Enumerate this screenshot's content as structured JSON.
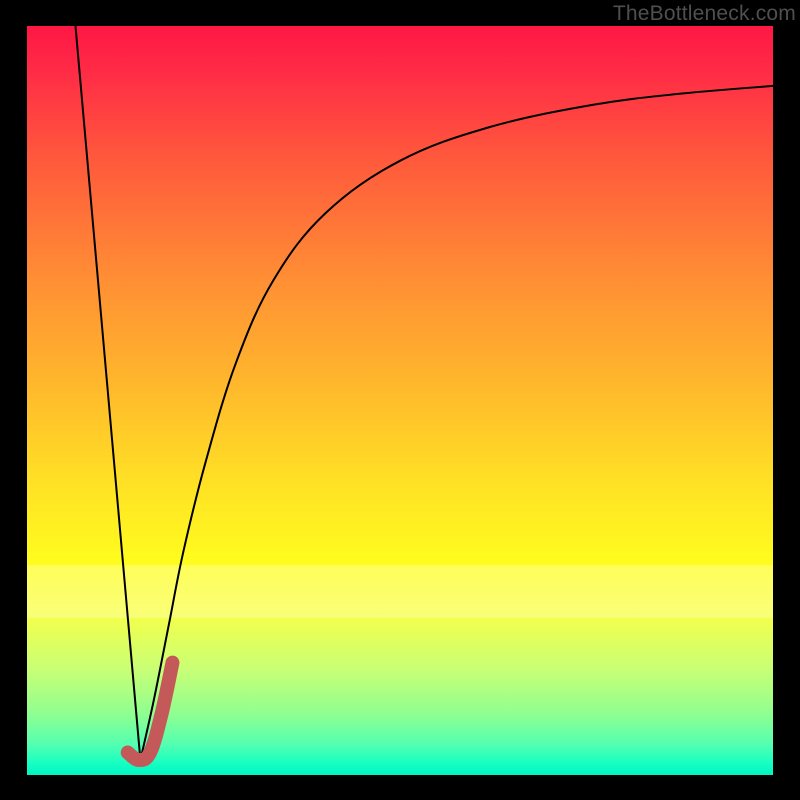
{
  "watermark": {
    "text": "TheBottleneck.com"
  },
  "colors": {
    "frame": "#000000",
    "watermark": "#4f4f4f",
    "curve": "#000000",
    "highlight": "#c4595a"
  },
  "chart_data": {
    "type": "line",
    "title": "",
    "xlabel": "",
    "ylabel": "",
    "xlim": [
      0,
      100
    ],
    "ylim": [
      0,
      100
    ],
    "grid": false,
    "legend": false,
    "series": [
      {
        "name": "left-line",
        "x": [
          6.5,
          15.2
        ],
        "y": [
          100,
          2
        ]
      },
      {
        "name": "right-curve",
        "x": [
          15.2,
          17.0,
          19.0,
          21.0,
          24.0,
          28.0,
          33.0,
          40.0,
          50.0,
          62.0,
          76.0,
          88.0,
          100.0
        ],
        "y": [
          2,
          10,
          20,
          30,
          42,
          55,
          66,
          75,
          82,
          86.5,
          89.5,
          91,
          92
        ]
      },
      {
        "name": "highlight-j",
        "x": [
          13.5,
          15.0,
          16.5,
          18.0,
          19.5
        ],
        "y": [
          3.0,
          2.0,
          3.0,
          8.0,
          15.0
        ]
      }
    ]
  }
}
